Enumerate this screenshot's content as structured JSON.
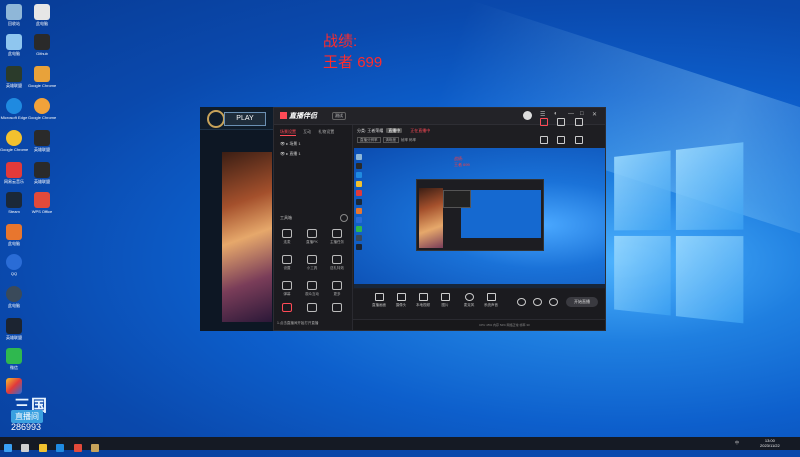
{
  "overlay": {
    "title": "战绩:",
    "rank_label": "王者",
    "rank_value": "699"
  },
  "desktop": {
    "icons": [
      {
        "label": "回收站",
        "color": "#8fb7d8"
      },
      {
        "label": "此电脑",
        "color": "#8fc6ef"
      },
      {
        "label": "Github",
        "color": "#2a2a2a"
      },
      {
        "label": "Microsoft Edge",
        "color": "#1f8ae0"
      },
      {
        "label": "Google Chrome",
        "color": "#f2c12e"
      },
      {
        "label": "网易云音乐",
        "color": "#e23a3a"
      },
      {
        "label": "Steam",
        "color": "#1b2838"
      },
      {
        "label": "WPS Office",
        "color": "#e24a3a"
      },
      {
        "label": "QQ",
        "color": "#2a6cd6"
      },
      {
        "label": "英雄联盟",
        "color": "#1c2431"
      },
      {
        "label": "微信",
        "color": "#2fb84f"
      }
    ]
  },
  "stream_badge": {
    "logo": "三国",
    "tag": "直播间",
    "room_id": "286993"
  },
  "launcher": {
    "play_label": "PLAY"
  },
  "app": {
    "brand": "直播伴侣",
    "version": "测试",
    "tabs": [
      "场景设置",
      "互动",
      "礼物设置"
    ],
    "scenes": [
      "场景 1",
      "直播 1"
    ],
    "tools_title": "工具箱",
    "tools": [
      "连麦",
      "直播PK",
      "主播任务",
      "设置",
      "小工具",
      "送礼特效",
      "弹幕",
      "观众互动",
      "更多",
      "付费",
      "抽奖",
      "其他"
    ],
    "left_bottom": "1.点击直播间开始打开直播",
    "header_text": "分类: 王者荣耀",
    "header_badge": "直播中",
    "header_red": "正在直播中",
    "header_chips": [
      "直播分辨率",
      "清晰度",
      "帧率",
      "码率"
    ],
    "preview_red_line1": "战绩:",
    "preview_red_line2": "王者 699",
    "actions": [
      "直播画面",
      "摄像头",
      "本地视频",
      "图片",
      "麦克风",
      "系统声音"
    ],
    "start_label": "开始直播",
    "status_text": "CPU 45%  内存 52%  网络正常  帧率 30"
  },
  "taskbar": {
    "icons": [
      "windows",
      "search",
      "explorer",
      "edge",
      "chrome",
      "game"
    ],
    "time": "13:00",
    "date": "2023/11/22",
    "tray": "中"
  }
}
